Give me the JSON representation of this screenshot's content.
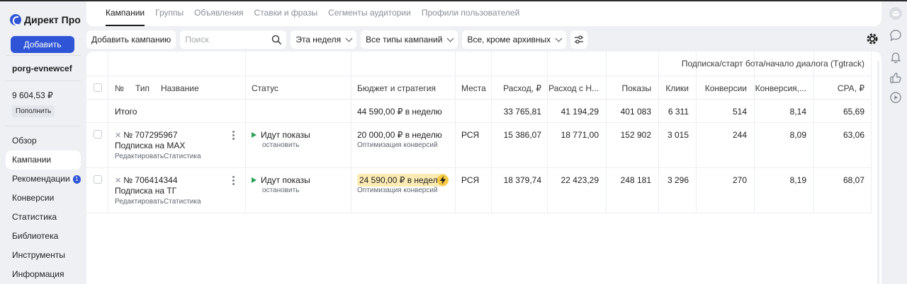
{
  "app": {
    "logo_text": "Директ Про",
    "add_label": "Добавить"
  },
  "account": {
    "login": "porg-evnewcef",
    "balance": "9 604,53 ₽",
    "topup_label": "Пополнить"
  },
  "nav": [
    {
      "label": "Обзор"
    },
    {
      "label": "Кампании",
      "active": true
    },
    {
      "label": "Рекомендации",
      "badge": "1"
    },
    {
      "label": "Конверсии"
    },
    {
      "label": "Статистика"
    },
    {
      "label": "Библиотека"
    },
    {
      "label": "Инструменты"
    },
    {
      "label": "Информация"
    }
  ],
  "tabs": [
    "Кампании",
    "Группы",
    "Объявления",
    "Ставки и фразы",
    "Сегменты аудитории",
    "Профили пользователей"
  ],
  "toolbar": {
    "add_campaign": "Добавить кампанию",
    "search_placeholder": "Поиск",
    "period": "Эта неделя",
    "campaign_types": "Все типы кампаний",
    "archive_filter": "Все, кроме архивных"
  },
  "table": {
    "goal_header": "Подписка/старт бота/начало диалога (Tgtrack)",
    "headers": {
      "num": "№",
      "type": "Тип",
      "name": "Название",
      "status": "Статус",
      "budget": "Бюджет и стратегия",
      "places": "Места",
      "spend": "Расход, ₽",
      "spend_vat": "Расход с Н...",
      "impressions": "Показы",
      "clicks": "Клики",
      "conversions": "Конверсии",
      "conv_rate": "Конверсия,...",
      "cpa": "CPA, ₽"
    },
    "total": {
      "label": "Итого",
      "budget": "44 590,00 ₽ в неделю",
      "spend": "33 765,81",
      "spend_vat": "41 194,29",
      "impressions": "401 083",
      "clicks": "6 311",
      "conversions": "514",
      "conv_rate": "8,14",
      "cpa": "65,69"
    },
    "rows": [
      {
        "num": "№ 707295967",
        "name": "Подписка на MAX",
        "edit": "Редактировать",
        "stats": "Статистика",
        "status": "Идут показы",
        "status_action": "остановить",
        "budget": "20 000,00 ₽ в неделю",
        "strategy": "Оптимизация конверсий",
        "places": "РСЯ",
        "spend": "15 386,07",
        "spend_vat": "18 771,00",
        "impressions": "152 902",
        "clicks": "3 015",
        "conversions": "244",
        "conv_rate": "8,09",
        "cpa": "63,06"
      },
      {
        "num": "№ 706414344",
        "name": "Подписка на ТГ",
        "edit": "Редактировать",
        "stats": "Статистика",
        "status": "Идут показы",
        "status_action": "остановить",
        "budget": "24 590,00 ₽ в неделю",
        "strategy": "Оптимизация конверсий",
        "places": "РСЯ",
        "spend": "18 379,74",
        "spend_vat": "22 423,29",
        "impressions": "248 181",
        "clicks": "3 296",
        "conversions": "270",
        "conv_rate": "8,19",
        "cpa": "68,07"
      }
    ]
  },
  "icons": {
    "rail": [
      "mail-icon",
      "chat-icon",
      "bell-icon",
      "thumbs-up-icon",
      "play-circle-icon"
    ],
    "accent": "#2f54d6",
    "status_green": "#2aa157",
    "highlight": "#fcebb3"
  }
}
